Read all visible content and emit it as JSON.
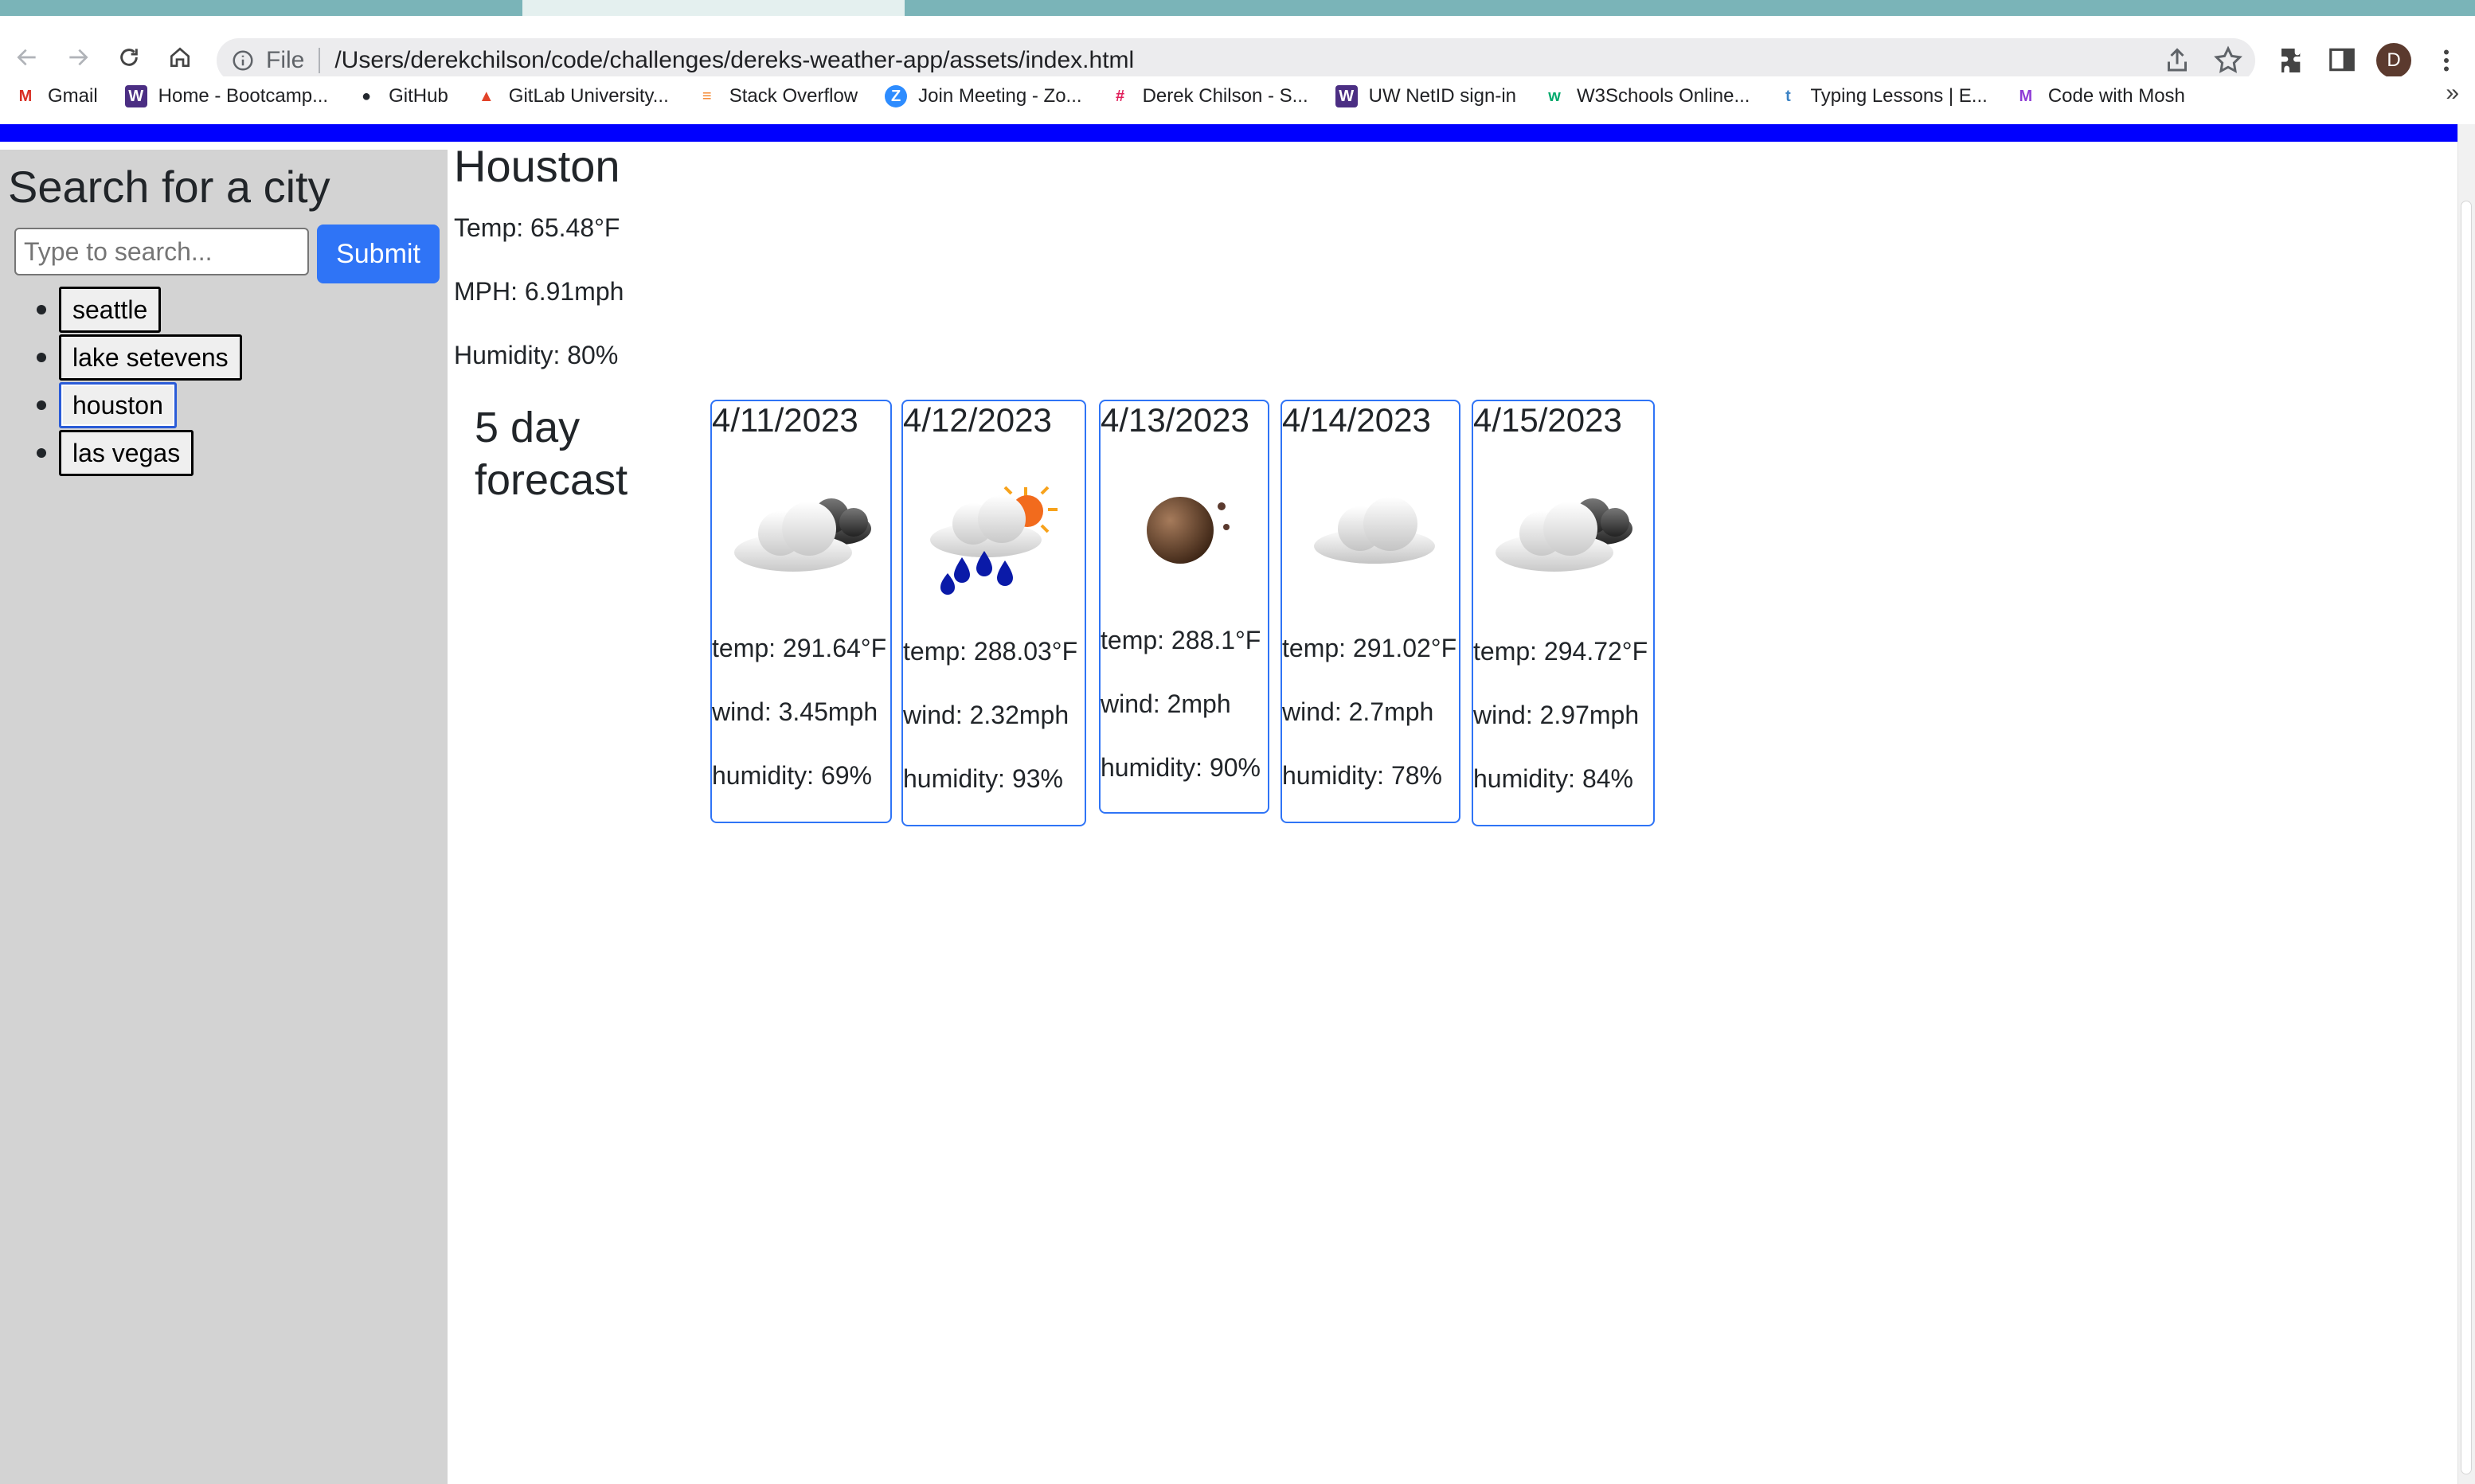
{
  "browser": {
    "url_scheme_label": "File",
    "url": "/Users/derekchilson/code/challenges/dereks-weather-app/assets/index.html",
    "profile_initial": "D",
    "bookmarks": [
      {
        "label": "Gmail",
        "icon": "gmail-icon",
        "color": "#d93025"
      },
      {
        "label": "Home - Bootcamp...",
        "icon": "uw-icon",
        "color": "#4b2e83"
      },
      {
        "label": "GitHub",
        "icon": "github-icon",
        "color": "#24292f"
      },
      {
        "label": "GitLab University...",
        "icon": "gitlab-icon",
        "color": "#e24329"
      },
      {
        "label": "Stack Overflow",
        "icon": "stackoverflow-icon",
        "color": "#f48024"
      },
      {
        "label": "Join Meeting - Zo...",
        "icon": "zoom-icon",
        "color": "#2d8cff"
      },
      {
        "label": "Derek Chilson - S...",
        "icon": "slack-icon",
        "color": "#e01e5a"
      },
      {
        "label": "UW NetID sign-in",
        "icon": "uw-icon",
        "color": "#4b2e83"
      },
      {
        "label": "W3Schools Online...",
        "icon": "w3schools-icon",
        "color": "#04aa6d"
      },
      {
        "label": "Typing Lessons | E...",
        "icon": "typing-icon",
        "color": "#3b82c4"
      },
      {
        "label": "Code with Mosh",
        "icon": "mosh-icon",
        "color": "#8e3bd6"
      }
    ]
  },
  "sidebar": {
    "title": "Search for a city",
    "search_placeholder": "Type to search...",
    "submit_label": "Submit",
    "cities": [
      "seattle",
      "lake setevens",
      "houston",
      "las vegas"
    ]
  },
  "current": {
    "city": "Houston",
    "temp": "Temp: 65.48°F",
    "mph": "MPH: 6.91mph",
    "humidity": "Humidity: 80%"
  },
  "forecast": {
    "heading": "5 day forecast",
    "days": [
      {
        "date": "4/11/2023",
        "icon": "cloudy-icon",
        "temp": "temp: 291.64°F",
        "wind": "wind: 3.45mph",
        "humidity": "humidity: 69%"
      },
      {
        "date": "4/12/2023",
        "icon": "rain-sun-icon",
        "temp": "temp: 288.03°F",
        "wind": "wind: 2.32mph",
        "humidity": "humidity: 93%"
      },
      {
        "date": "4/13/2023",
        "icon": "clear-night-icon",
        "temp": "temp: 288.1°F",
        "wind": "wind: 2mph",
        "humidity": "humidity: 90%"
      },
      {
        "date": "4/14/2023",
        "icon": "cloud-icon",
        "temp": "temp: 291.02°F",
        "wind": "wind: 2.7mph",
        "humidity": "humidity: 78%"
      },
      {
        "date": "4/15/2023",
        "icon": "cloudy-icon",
        "temp": "temp: 294.72°F",
        "wind": "wind: 2.97mph",
        "humidity": "humidity: 84%"
      }
    ]
  },
  "colors": {
    "accent": "#2f74f6",
    "header_bar": "#0000ff",
    "sidebar_bg": "#d3d3d3"
  }
}
